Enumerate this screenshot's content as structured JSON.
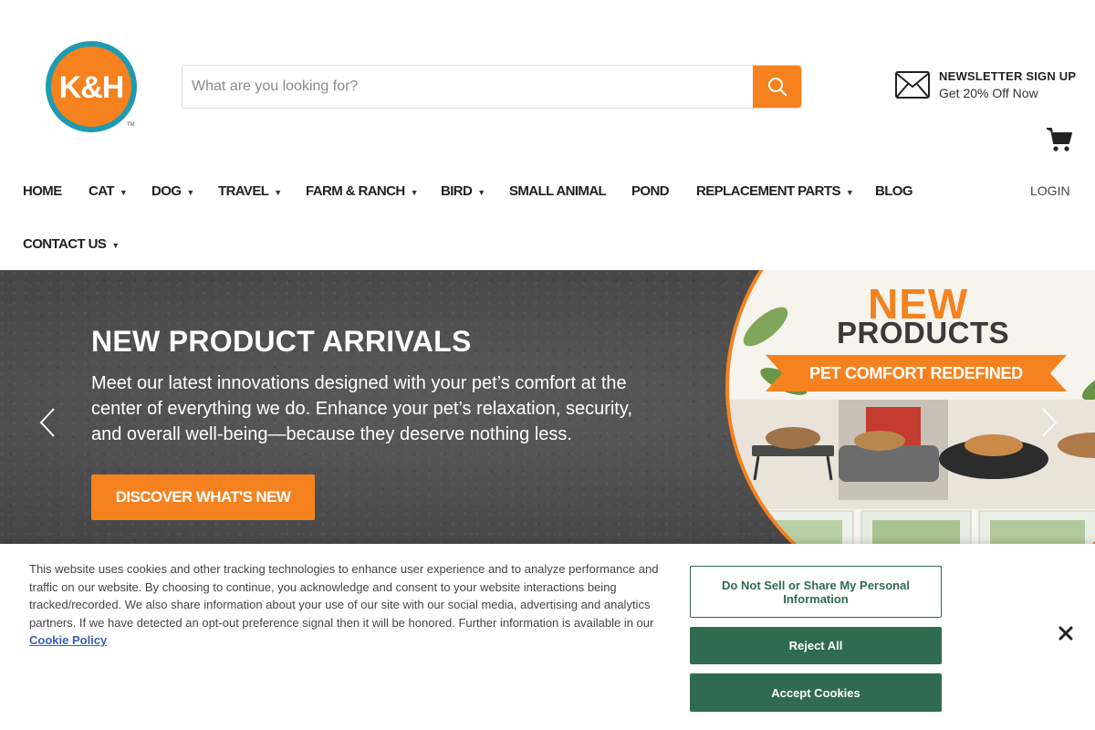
{
  "brand": {
    "logo_text": "K&H",
    "accent": "#f5821f",
    "teal": "#1e9bb0"
  },
  "search": {
    "placeholder": "What are you looking for?",
    "icon": "search-icon"
  },
  "newsletter": {
    "title": "NEWSLETTER SIGN UP",
    "subtitle": "Get 20% Off Now",
    "icon": "mail-icon"
  },
  "cart": {
    "icon": "cart-icon"
  },
  "nav": {
    "items": [
      {
        "label": "HOME",
        "dropdown": false
      },
      {
        "label": "CAT",
        "dropdown": true
      },
      {
        "label": "DOG",
        "dropdown": true
      },
      {
        "label": "TRAVEL",
        "dropdown": true
      },
      {
        "label": "FARM & RANCH",
        "dropdown": true
      },
      {
        "label": "BIRD",
        "dropdown": true
      },
      {
        "label": "SMALL ANIMAL",
        "dropdown": false
      },
      {
        "label": "POND",
        "dropdown": false
      },
      {
        "label": "REPLACEMENT PARTS",
        "dropdown": true
      },
      {
        "label": "BLOG",
        "dropdown": false
      },
      {
        "label": "CONTACT US",
        "dropdown": true
      }
    ],
    "login": "LOGIN"
  },
  "hero": {
    "title": "NEW PRODUCT ARRIVALS",
    "description": "Meet our latest innovations designed with your pet’s comfort at the center of everything we do. Enhance your pet’s relaxation, security, and overall well-being—because they deserve nothing less.",
    "button": "DISCOVER WHAT'S NEW",
    "promo": {
      "line1": "NEW",
      "line2": "PRODUCTS",
      "ribbon": "PET COMFORT REDEFINED"
    }
  },
  "cookie": {
    "text": "This website uses cookies and other tracking technologies to enhance user experience and to analyze performance and traffic on our website. By choosing to continue, you acknowledge and consent to your website interactions being tracked/recorded. We also share information about your use of our site with our social media, advertising and analytics partners. If we have detected an opt-out preference signal then it will be honored. Further information is available in our",
    "link": "Cookie Policy",
    "do_not_sell": "Do Not Sell or Share My Personal Information",
    "reject": "Reject All",
    "accept": "Accept Cookies",
    "color": "#2f6b4f"
  }
}
